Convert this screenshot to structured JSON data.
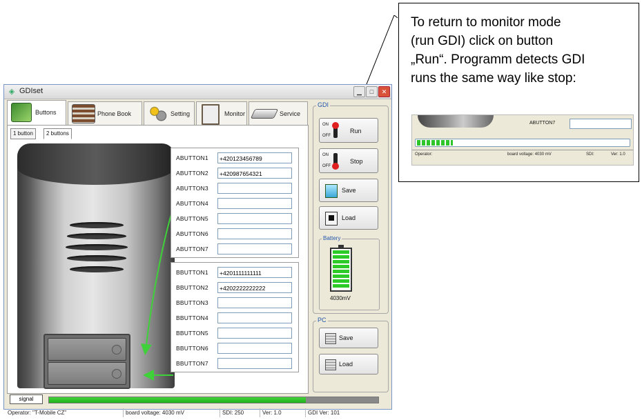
{
  "window": {
    "title": "GDIset"
  },
  "tabs": [
    {
      "label": "Buttons"
    },
    {
      "label": "Phone Book"
    },
    {
      "label": "Setting"
    },
    {
      "label": "Monitor"
    },
    {
      "label": "Service"
    }
  ],
  "subtabs": [
    {
      "label": "1 button"
    },
    {
      "label": "2 buttons"
    }
  ],
  "group_a": {
    "rows": [
      {
        "label": "ABUTTON1",
        "value": "+420123456789"
      },
      {
        "label": "ABUTTON2",
        "value": "+420987654321"
      },
      {
        "label": "ABUTTON3",
        "value": ""
      },
      {
        "label": "ABUTTON4",
        "value": ""
      },
      {
        "label": "ABUTTON5",
        "value": ""
      },
      {
        "label": "ABUTTON6",
        "value": ""
      },
      {
        "label": "ABUTTON7",
        "value": ""
      }
    ]
  },
  "group_b": {
    "rows": [
      {
        "label": "BBUTTON1",
        "value": "+4201111111111"
      },
      {
        "label": "BBUTTON2",
        "value": "+4202222222222"
      },
      {
        "label": "BBUTTON3",
        "value": ""
      },
      {
        "label": "BBUTTON4",
        "value": ""
      },
      {
        "label": "BBUTTON5",
        "value": ""
      },
      {
        "label": "BBUTTON6",
        "value": ""
      },
      {
        "label": "BBUTTON7",
        "value": ""
      }
    ]
  },
  "gdi": {
    "legend": "GDI",
    "on_label": "ON",
    "off_label": "OFF",
    "run_label": "Run",
    "stop_label": "Stop",
    "save_label": "Save",
    "load_label": "Load"
  },
  "battery": {
    "legend": "Battery",
    "value": "4030mV",
    "level": 1.0
  },
  "pc": {
    "legend": "PC",
    "save_label": "Save",
    "load_label": "Load"
  },
  "progress": {
    "label": "signal",
    "fraction": 0.78
  },
  "status": {
    "operator": "Operator: \"T-Mobile CZ\"",
    "voltage": "board voltage: 4030 mV",
    "sdi": "SDI: 250",
    "ver": "Ver: 1.0",
    "gdi_ver": "GDI Ver: 101"
  },
  "callout": {
    "text": "To return to monitor mode\n(run GDI) click on button\n„Run“. Programm detects GDI\nruns the same way like stop:",
    "mini": {
      "field_label": "ABUTTON7",
      "operator": "Operator:",
      "voltage": "board voltage: 4030 mV",
      "sdi": "SDI:",
      "ver": "Ver: 1.0"
    }
  },
  "colors": {
    "accent": "#1fb11b",
    "titlebar": "#e0e0e0",
    "close": "#d9533b",
    "panel": "#ece9d8"
  }
}
